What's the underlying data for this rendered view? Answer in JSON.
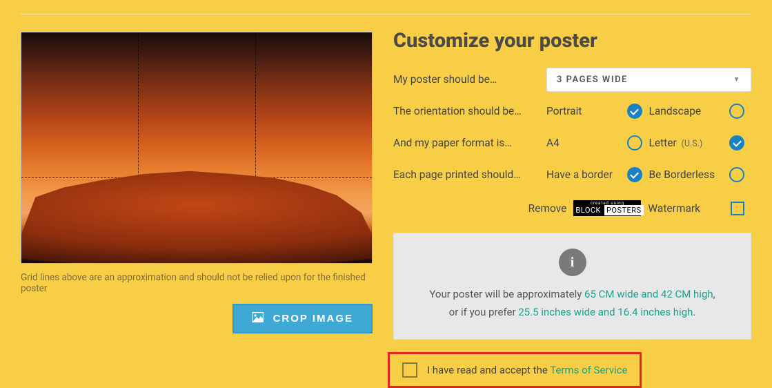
{
  "left": {
    "grid_caption": "Grid lines above are an approximation and should not be relied upon for the finished poster",
    "crop_button": "CROP IMAGE"
  },
  "title": "Customize your poster",
  "options": {
    "pages": {
      "label": "My poster should be…",
      "selected": "3 PAGES WIDE"
    },
    "orientation": {
      "label": "The orientation should be…",
      "a": "Portrait",
      "b": "Landscape",
      "selected": "Portrait"
    },
    "paper": {
      "label": "And my paper format is…",
      "a": "A4",
      "b": "Letter",
      "b_sub": "(U.S.)",
      "selected": "Letter"
    },
    "border": {
      "label": "Each page printed should…",
      "a": "Have a border",
      "b": "Be Borderless",
      "selected": "Have a border"
    },
    "watermark": {
      "remove": "Remove",
      "watermark": "Watermark",
      "badge_top": "created using",
      "badge_b1": "BLOCK",
      "badge_b2": "POSTERS",
      "checked": false
    }
  },
  "info": {
    "line1_a": "Your poster will be approximately ",
    "line1_hl": "65 CM wide and 42 CM high",
    "line2_a": "or if you prefer ",
    "line2_hl": "25.5 inches wide and 16.4 inches high"
  },
  "tos": {
    "text": "I have read and accept the ",
    "link": "Terms of Service",
    "checked": false
  }
}
